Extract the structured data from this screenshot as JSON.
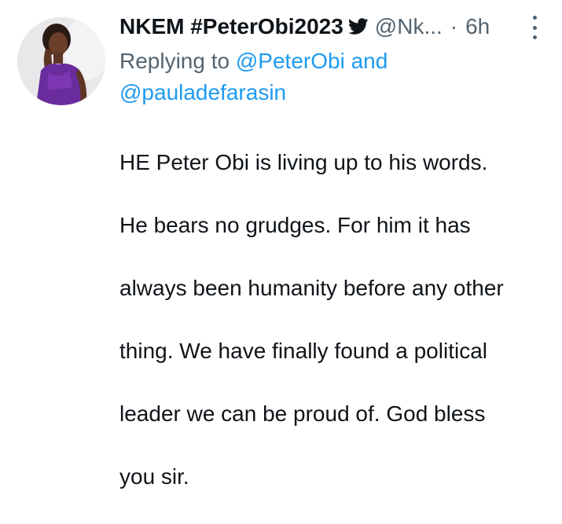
{
  "tweet": {
    "author": {
      "display_name": "NKEM #PeterObi2023",
      "handle": "@Nk...",
      "verified_emoji": "bird-icon"
    },
    "separator": "·",
    "time": "6h",
    "replying": {
      "prefix": "Replying to",
      "mention_1": "@PeterObi",
      "conjunction": "and",
      "mention_2": "@pauladefarasin"
    },
    "text_lines": [
      "HE Peter Obi is living up to his words.",
      "He bears no grudges. For him it has",
      "always been humanity before any other",
      "thing. We have finally found a political",
      "leader we can be proud of. God bless",
      "you sir."
    ]
  },
  "colors": {
    "text_primary": "#0f1419",
    "text_secondary": "#536471",
    "link": "#1d9bf0",
    "background": "#ffffff"
  }
}
